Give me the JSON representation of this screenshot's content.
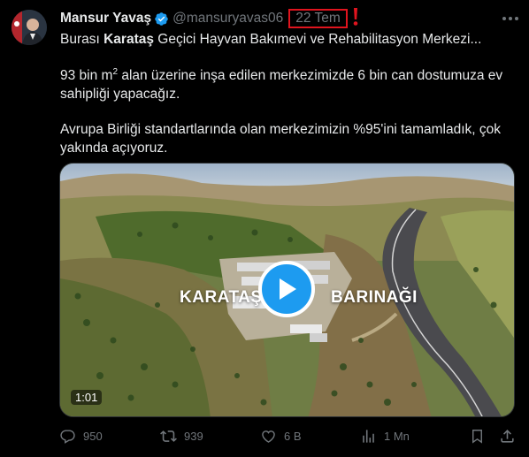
{
  "author": {
    "name": "Mansur Yavaş",
    "handle": "@mansuryavas06",
    "verified": true
  },
  "date": "22 Tem",
  "annotation": {
    "mark": "!",
    "color": "#e0141e"
  },
  "text": {
    "p1_prefix": "Burası ",
    "p1_bold": "Karataş",
    "p1_suffix": " Geçici Hayvan Bakımevi ve Rehabilitasyon Merkezi...",
    "p2_before": "93 bin m",
    "p2_sup": "2",
    "p2_after": " alan üzerine inşa edilen merkezimizde 6 bin can dostumuza ev sahipliği yapacağız.",
    "p3": "Avrupa Birliği standartlarında olan merkezimizin %95'ini tamamladık, çok yakında açıyoruz."
  },
  "media": {
    "overlay_left": "KARATAŞ",
    "overlay_right": "BARINAĞI",
    "duration": "1:01",
    "play_icon": "play-icon"
  },
  "actions": {
    "replies": "950",
    "reposts": "939",
    "likes": "6 B",
    "views": "1 Mn"
  },
  "colors": {
    "background": "#000000",
    "text": "#e7e9ea",
    "muted": "#71767b",
    "accent": "#1d9bf0",
    "highlight_box": "#e0141e"
  }
}
